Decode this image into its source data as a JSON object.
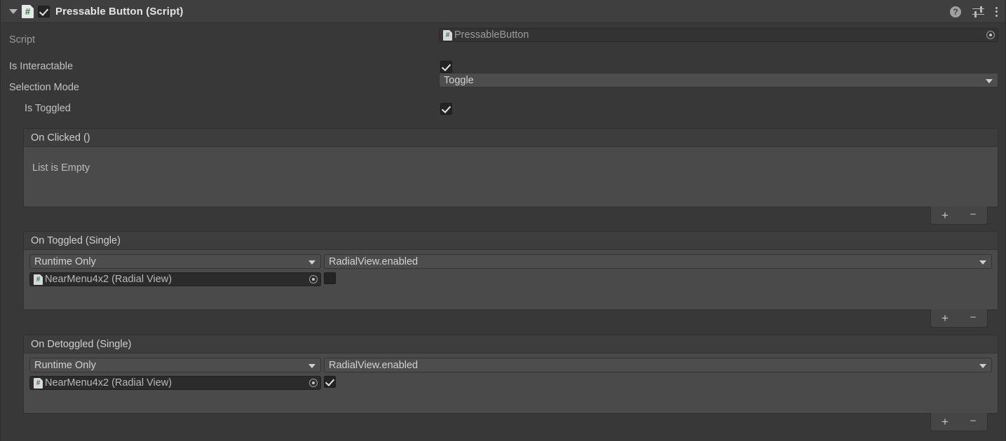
{
  "component": {
    "title": "Pressable Button (Script)",
    "enabled": true,
    "expanded": true,
    "icons": {
      "foldout": "triangle-down-icon",
      "script": "csharp-script-icon",
      "help": "?",
      "settings": "preset-sliders-icon",
      "menu": "kebab-menu-icon"
    }
  },
  "properties": {
    "script": {
      "label": "Script",
      "value": "PressableButton",
      "disabled": true
    },
    "is_interactable": {
      "label": "Is Interactable",
      "checked": true
    },
    "selection_mode": {
      "label": "Selection Mode",
      "value": "Toggle"
    },
    "is_toggled": {
      "label": "Is Toggled",
      "checked": true
    }
  },
  "events": [
    {
      "title": "On Clicked ()",
      "empty": true,
      "empty_text": "List is Empty",
      "entries": []
    },
    {
      "title": "On Toggled (Single)",
      "empty": false,
      "entries": [
        {
          "call_state": "Runtime Only",
          "function": "RadialView.enabled",
          "target_object": "NearMenu4x2 (Radial View)",
          "argument_checked": false
        }
      ]
    },
    {
      "title": "On Detoggled (Single)",
      "empty": false,
      "entries": [
        {
          "call_state": "Runtime Only",
          "function": "RadialView.enabled",
          "target_object": "NearMenu4x2 (Radial View)",
          "argument_checked": true
        }
      ]
    }
  ],
  "list_controls": {
    "add_label": "+",
    "remove_label": "−"
  },
  "colors": {
    "panel_bg": "#383838",
    "header_bg": "#3f3f3f",
    "box_bg": "#4a4a4a",
    "box_header_bg": "#3d3d3d",
    "dropdown_bg": "#4d4d4d",
    "field_bg": "#2b2b2b",
    "text": "#c4c4c4",
    "script_green": "#2a7d3a"
  }
}
